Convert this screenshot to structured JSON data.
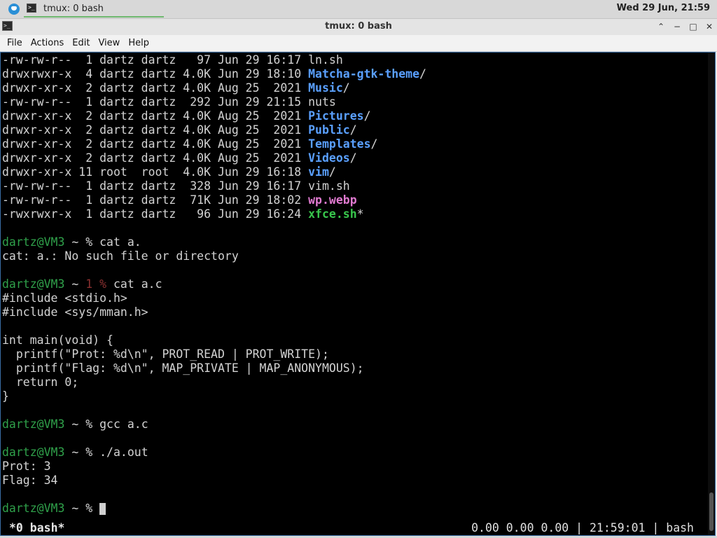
{
  "panel": {
    "task_title": "tmux: 0 bash",
    "clock": "Wed 29 Jun, 21:59"
  },
  "window": {
    "title": "tmux: 0 bash",
    "buttons": {
      "keep_above": "⌃",
      "minimize": "−",
      "maximize": "□",
      "close": "✕"
    }
  },
  "menu": [
    "File",
    "Actions",
    "Edit",
    "View",
    "Help"
  ],
  "colors": {
    "dir": "#5aa0ff",
    "image": "#e07ad0",
    "exec": "#38c64c",
    "prompt_user": "#2fa04a"
  },
  "listing": [
    {
      "perm": "-rw-rw-r--",
      "links": " 1",
      "owner": "dartz",
      "group": "dartz",
      "size": "  97",
      "date": "Jun 29 16:17",
      "name": "ln.sh",
      "kind": "file"
    },
    {
      "perm": "drwxrwxr-x",
      "links": " 4",
      "owner": "dartz",
      "group": "dartz",
      "size": "4.0K",
      "date": "Jun 29 18:10",
      "name": "Matcha-gtk-theme",
      "suffix": "/",
      "kind": "dir"
    },
    {
      "perm": "drwxr-xr-x",
      "links": " 2",
      "owner": "dartz",
      "group": "dartz",
      "size": "4.0K",
      "date": "Aug 25  2021",
      "name": "Music",
      "suffix": "/",
      "kind": "dir"
    },
    {
      "perm": "-rw-rw-r--",
      "links": " 1",
      "owner": "dartz",
      "group": "dartz",
      "size": " 292",
      "date": "Jun 29 21:15",
      "name": "nuts",
      "kind": "file"
    },
    {
      "perm": "drwxr-xr-x",
      "links": " 2",
      "owner": "dartz",
      "group": "dartz",
      "size": "4.0K",
      "date": "Aug 25  2021",
      "name": "Pictures",
      "suffix": "/",
      "kind": "dir"
    },
    {
      "perm": "drwxr-xr-x",
      "links": " 2",
      "owner": "dartz",
      "group": "dartz",
      "size": "4.0K",
      "date": "Aug 25  2021",
      "name": "Public",
      "suffix": "/",
      "kind": "dir"
    },
    {
      "perm": "drwxr-xr-x",
      "links": " 2",
      "owner": "dartz",
      "group": "dartz",
      "size": "4.0K",
      "date": "Aug 25  2021",
      "name": "Templates",
      "suffix": "/",
      "kind": "dir"
    },
    {
      "perm": "drwxr-xr-x",
      "links": " 2",
      "owner": "dartz",
      "group": "dartz",
      "size": "4.0K",
      "date": "Aug 25  2021",
      "name": "Videos",
      "suffix": "/",
      "kind": "dir"
    },
    {
      "perm": "drwxr-xr-x",
      "links": "11",
      "owner": "root ",
      "group": "root ",
      "size": "4.0K",
      "date": "Jun 29 16:18",
      "name": "vim",
      "suffix": "/",
      "kind": "dir"
    },
    {
      "perm": "-rw-rw-r--",
      "links": " 1",
      "owner": "dartz",
      "group": "dartz",
      "size": " 328",
      "date": "Jun 29 16:17",
      "name": "vim.sh",
      "kind": "file"
    },
    {
      "perm": "-rw-rw-r--",
      "links": " 1",
      "owner": "dartz",
      "group": "dartz",
      "size": " 71K",
      "date": "Jun 29 18:02",
      "name": "wp.webp",
      "kind": "image"
    },
    {
      "perm": "-rwxrwxr-x",
      "links": " 1",
      "owner": "dartz",
      "group": "dartz",
      "size": "  96",
      "date": "Jun 29 16:24",
      "name": "xfce.sh",
      "suffix": "*",
      "kind": "exec"
    }
  ],
  "prompt": {
    "user_host": "dartz@VM3",
    "path": " ~ ",
    "symbol": "% ",
    "exit_code": "1"
  },
  "session": {
    "cmd1": "cat a.",
    "out1": "cat: a.: No such file or directory",
    "cmd2": "cat a.c",
    "source": [
      "#include <stdio.h>",
      "#include <sys/mman.h>",
      "",
      "int main(void) {",
      "  printf(\"Prot: %d\\n\", PROT_READ | PROT_WRITE);",
      "  printf(\"Flag: %d\\n\", MAP_PRIVATE | MAP_ANONYMOUS);",
      "  return 0;",
      "}"
    ],
    "cmd3": "gcc a.c",
    "cmd4": "./a.out",
    "out4": [
      "Prot: 3",
      "Flag: 34"
    ]
  },
  "status": {
    "window": "*0 bash*",
    "right": "0.00 0.00 0.00 | 21:59:01 | bash"
  }
}
